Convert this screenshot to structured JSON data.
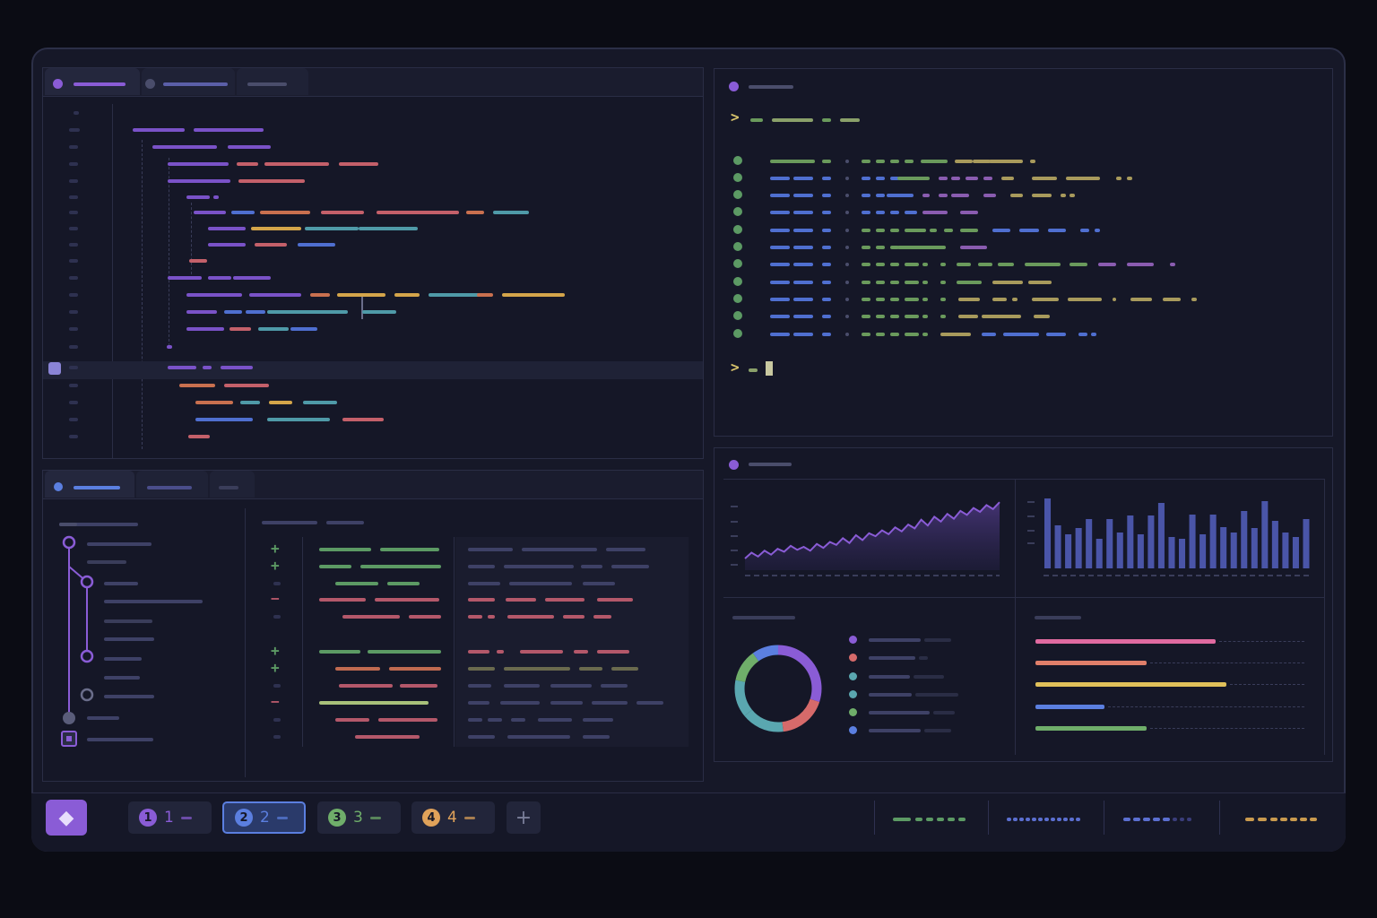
{
  "colors": {
    "background": "#0b0c14",
    "purple": "#8a5cd6",
    "blue": "#5b7fe0",
    "green": "#6fae6a",
    "orange": "#e0a25a",
    "red": "#d66a6a",
    "yellow": "#d8c46c",
    "teal": "#5aa7b0"
  },
  "terminal": {
    "prompt_symbol": ">"
  },
  "diff": {
    "added_symbol": "+",
    "removed_symbol": "−"
  },
  "taskbar": {
    "launcher_icon": "app-launcher-icon",
    "workspaces": [
      {
        "badge": "1",
        "label": "1",
        "color": "#8a5cd6"
      },
      {
        "badge": "2",
        "label": "2",
        "color": "#5b7fe0",
        "active": true
      },
      {
        "badge": "3",
        "label": "3",
        "color": "#6fae6a"
      },
      {
        "badge": "4",
        "label": "4",
        "color": "#e0a25a"
      }
    ],
    "add_workspace_label": "+"
  },
  "dashboard": {
    "chart_data": [
      {
        "type": "area",
        "values": [
          12,
          18,
          14,
          20,
          16,
          22,
          19,
          25,
          21,
          24,
          20,
          27,
          23,
          29,
          26,
          33,
          28,
          36,
          31,
          38,
          35,
          41,
          37,
          44,
          40,
          47,
          43,
          52,
          46,
          55,
          50,
          58,
          53,
          61,
          57,
          64,
          60,
          67,
          63,
          70
        ]
      },
      {
        "type": "bar",
        "values": [
          78,
          48,
          38,
          45,
          55,
          33,
          55,
          40,
          59,
          38,
          59,
          73,
          35,
          33,
          60,
          38,
          60,
          46,
          40,
          64,
          45,
          75,
          53,
          40,
          35,
          55
        ]
      },
      {
        "type": "pie",
        "values": [
          30,
          18,
          16,
          14,
          12,
          10
        ],
        "colors": [
          "#8a5cd6",
          "#d66a6a",
          "#5aa7b0",
          "#5aa7b0",
          "#6fae6a",
          "#5b7fe0"
        ]
      },
      {
        "type": "bar",
        "orientation": "horizontal",
        "values": [
          68,
          42,
          72,
          26,
          42
        ],
        "colors": [
          "#e06aa0",
          "#e07f6a",
          "#e0c05a",
          "#5b7fe0",
          "#6fae6a"
        ]
      }
    ]
  }
}
